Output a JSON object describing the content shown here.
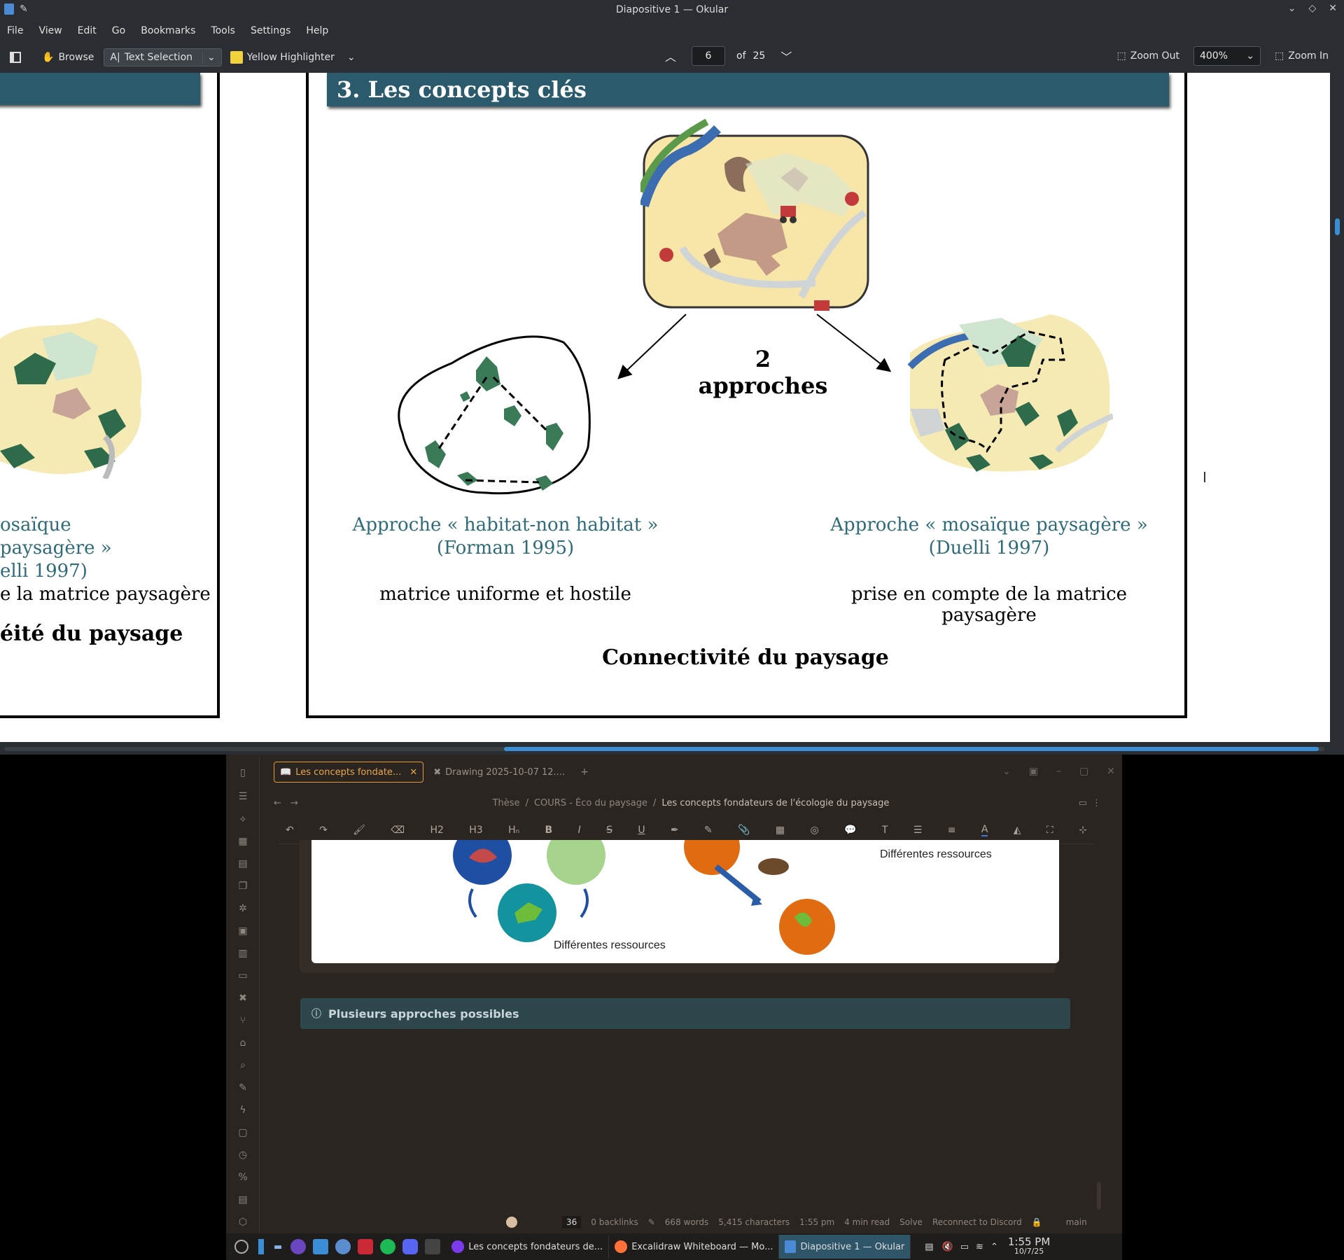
{
  "okular": {
    "window_title": "Diapositive 1 — Okular",
    "menu": [
      "File",
      "View",
      "Edit",
      "Go",
      "Bookmarks",
      "Tools",
      "Settings",
      "Help"
    ],
    "toolbar": {
      "browse": "Browse",
      "text_selection": "Text Selection",
      "highlighter": "Yellow Highlighter",
      "page_current": "6",
      "page_of": "of",
      "page_total": "25",
      "zoom_out": "Zoom Out",
      "zoom_value": "400%",
      "zoom_in": "Zoom In"
    },
    "slide": {
      "heading": "3. Les concepts clés",
      "center_label": "2 approches",
      "left_title_1": "Approche « habitat-non habitat »",
      "left_title_2": "(Forman 1995)",
      "right_title_1": "Approche « mosaïque paysagère »",
      "right_title_2": "(Duelli 1997)",
      "left_desc": "matrice uniforme et hostile",
      "right_desc": "prise en compte de la matrice paysagère",
      "footer": "Connectivité du paysage"
    },
    "prev_slide": {
      "title_1": "osaïque paysagère »",
      "title_2": "elli 1997)",
      "desc": "e la matrice paysagère",
      "footer": "éité du paysage"
    }
  },
  "obsidian": {
    "tabs": [
      {
        "label": "Les concepts fondate...",
        "active": true
      },
      {
        "label": "Drawing 2025-10-07 12....",
        "active": false
      }
    ],
    "breadcrumb": [
      "Thèse",
      "COURS - Éco du paysage",
      "Les concepts fondateurs de l'écologie du paysage"
    ],
    "format_buttons": [
      "H2",
      "H3",
      "Hₙ",
      "B",
      "I",
      "S",
      "U"
    ],
    "drawing_labels": [
      "Différentes ressources",
      "Différentes ressources"
    ],
    "callout": "Plusieurs approches possibles",
    "status": {
      "number": "36",
      "backlinks": "0 backlinks",
      "words": "668 words",
      "chars": "5,415 characters",
      "time": "1:55 pm",
      "read": "4 min read",
      "solve": "Solve",
      "discord": "Reconnect to Discord",
      "branch": "main"
    }
  },
  "taskbar": {
    "tasks": [
      "Les concepts fondateurs de...",
      "Excalidraw Whiteboard — Mo...",
      "Diapositive 1 — Okular"
    ],
    "clock_time": "1:55 PM",
    "clock_date": "10/7/25"
  }
}
